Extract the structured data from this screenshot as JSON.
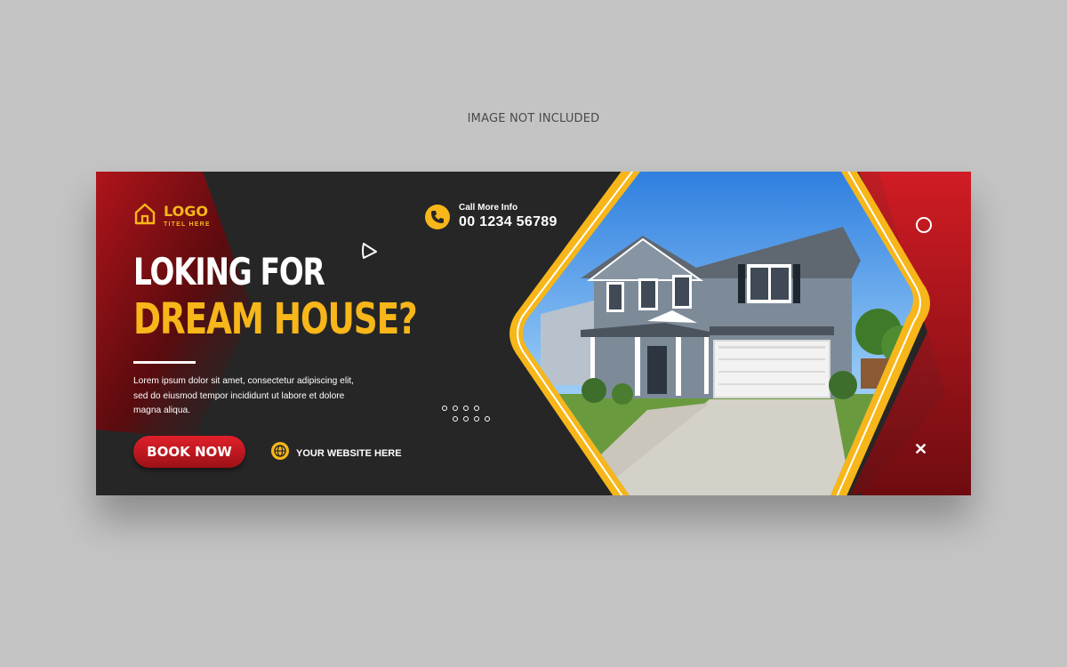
{
  "notice": "IMAGE NOT INCLUDED",
  "logo": {
    "title": "LOGO",
    "subtitle": "TITEL HERE"
  },
  "contact": {
    "label": "Call More Info",
    "number": "00 1234 56789"
  },
  "headline": {
    "line1": "LOKING FOR",
    "line2": "DREAM HOUSE?"
  },
  "body": "Lorem ipsum dolor sit amet, consectetur adipiscing elit, sed do eiusmod tempor incididunt ut labore et dolore magna aliqua.",
  "cta": {
    "button": "BOOK NOW",
    "website": "YOUR WEBSITE HERE"
  },
  "colors": {
    "accent": "#f7b619",
    "red": "#c0161d",
    "dark": "#262626",
    "canvas": "#c4c4c4"
  },
  "icons": [
    "house-logo-icon",
    "phone-icon",
    "globe-icon",
    "play-icon",
    "circle-icon",
    "close-icon",
    "dots-pattern"
  ]
}
